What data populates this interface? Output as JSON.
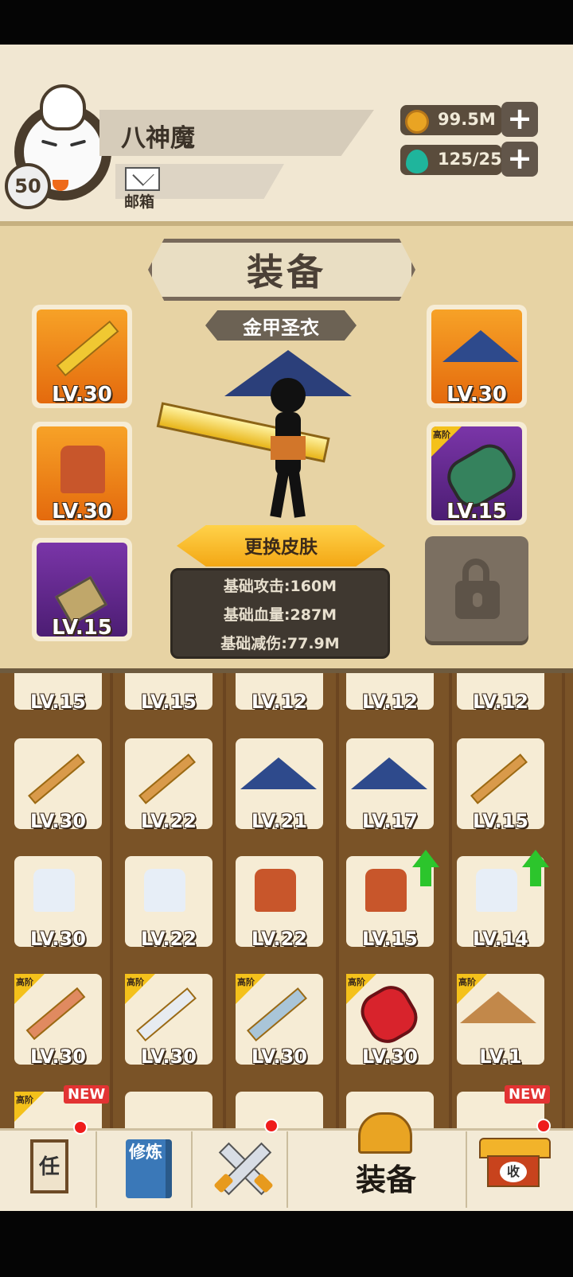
{
  "player": {
    "name": "八神魔",
    "level": "50",
    "mailbox_label": "邮箱"
  },
  "resources": {
    "coins": "99.5M",
    "gems": "125/25"
  },
  "equipment": {
    "title": "装备",
    "outfit_name": "金甲圣衣",
    "change_skin_label": "更换皮肤",
    "stats": {
      "attack": "基础攻击:160M",
      "hp": "基础血量:287M",
      "defense": "基础减伤:77.9M"
    },
    "slots": [
      {
        "level": "LV.30",
        "item": "sword-icon",
        "tier": "normal"
      },
      {
        "level": "LV.30",
        "item": "armor-icon",
        "tier": "normal"
      },
      {
        "level": "LV.15",
        "item": "amulet-icon",
        "tier": "purple"
      },
      {
        "level": "LV.30",
        "item": "hat-icon",
        "tier": "normal"
      },
      {
        "level": "LV.15",
        "item": "barrel-icon",
        "tier": "advanced",
        "tag": "高阶"
      }
    ]
  },
  "inventory": {
    "partial_row": [
      "LV.15",
      "LV.15",
      "LV.12",
      "LV.12",
      "LV.12"
    ],
    "rows": [
      [
        "LV.30",
        "LV.22",
        "LV.21",
        "LV.17",
        "LV.15"
      ],
      [
        "LV.30",
        "LV.22",
        "LV.22",
        "LV.15",
        "LV.14"
      ],
      [
        "LV.30",
        "LV.30",
        "LV.30",
        "LV.30",
        "LV.1"
      ]
    ],
    "advanced_tag": "高阶",
    "new_badge": "NEW"
  },
  "nav": {
    "tasks_char": "任",
    "training_char": "修炼",
    "equip_label": "装备",
    "shop_char": "收"
  },
  "colors": {
    "accent": "#f3a714",
    "panel": "#e7d3a4",
    "inventory_bg": "#7a5327"
  }
}
